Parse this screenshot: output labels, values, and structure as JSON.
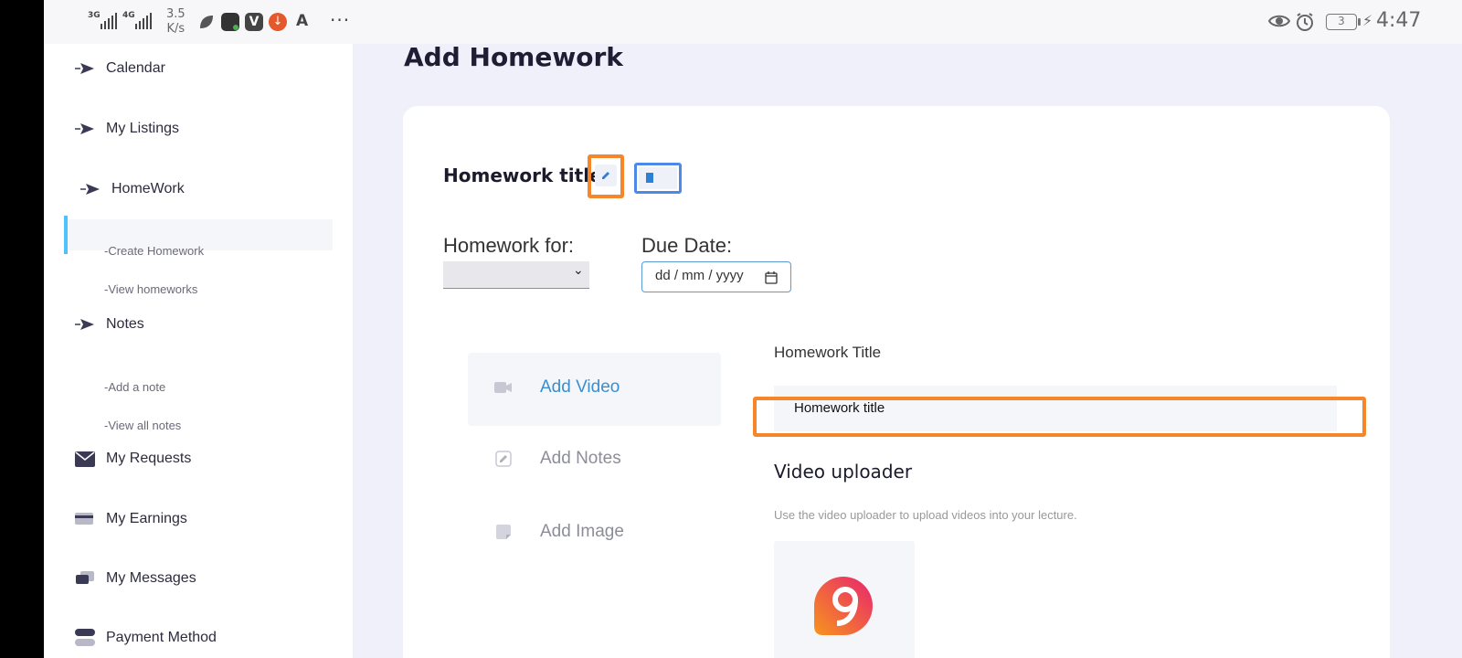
{
  "status_bar": {
    "net1": "3G",
    "net2": "4G",
    "speed_value": "3.5",
    "speed_unit": "K/s",
    "more": "···",
    "battery": "3",
    "time": "4:47"
  },
  "sidebar": {
    "items": [
      {
        "label": "Calendar"
      },
      {
        "label": "My Listings"
      },
      {
        "label": "HomeWork"
      },
      {
        "label": "Notes"
      },
      {
        "label": "My Requests"
      },
      {
        "label": "My Earnings"
      },
      {
        "label": "My Messages"
      },
      {
        "label": "Payment Method"
      }
    ],
    "homework_sub": [
      "-Create Homework",
      "-View homeworks"
    ],
    "notes_sub": [
      "-Add a note",
      "-View all notes"
    ]
  },
  "main": {
    "page_title": "Add Homework",
    "homework_title_label": "Homework title",
    "homework_for_label": "Homework for:",
    "homework_for_value": "",
    "due_date_label": "Due Date:",
    "due_date_placeholder": "dd / mm / yyyy",
    "tabs": [
      {
        "label": "Add Video",
        "icon": "video-icon"
      },
      {
        "label": "Add Notes",
        "icon": "edit-icon"
      },
      {
        "label": "Add Image",
        "icon": "image-icon"
      }
    ],
    "hw_title_field_label": "Homework Title",
    "hw_title_field_value": "Homework title",
    "video_uploader_heading": "Video uploader",
    "video_uploader_desc": "Use the video uploader to upload videos into your lecture."
  },
  "colors": {
    "accent": "#3a8ed0",
    "highlight_orange": "#f5862a",
    "highlight_blue": "#4e89e8",
    "active_bar": "#4fc3f7"
  }
}
